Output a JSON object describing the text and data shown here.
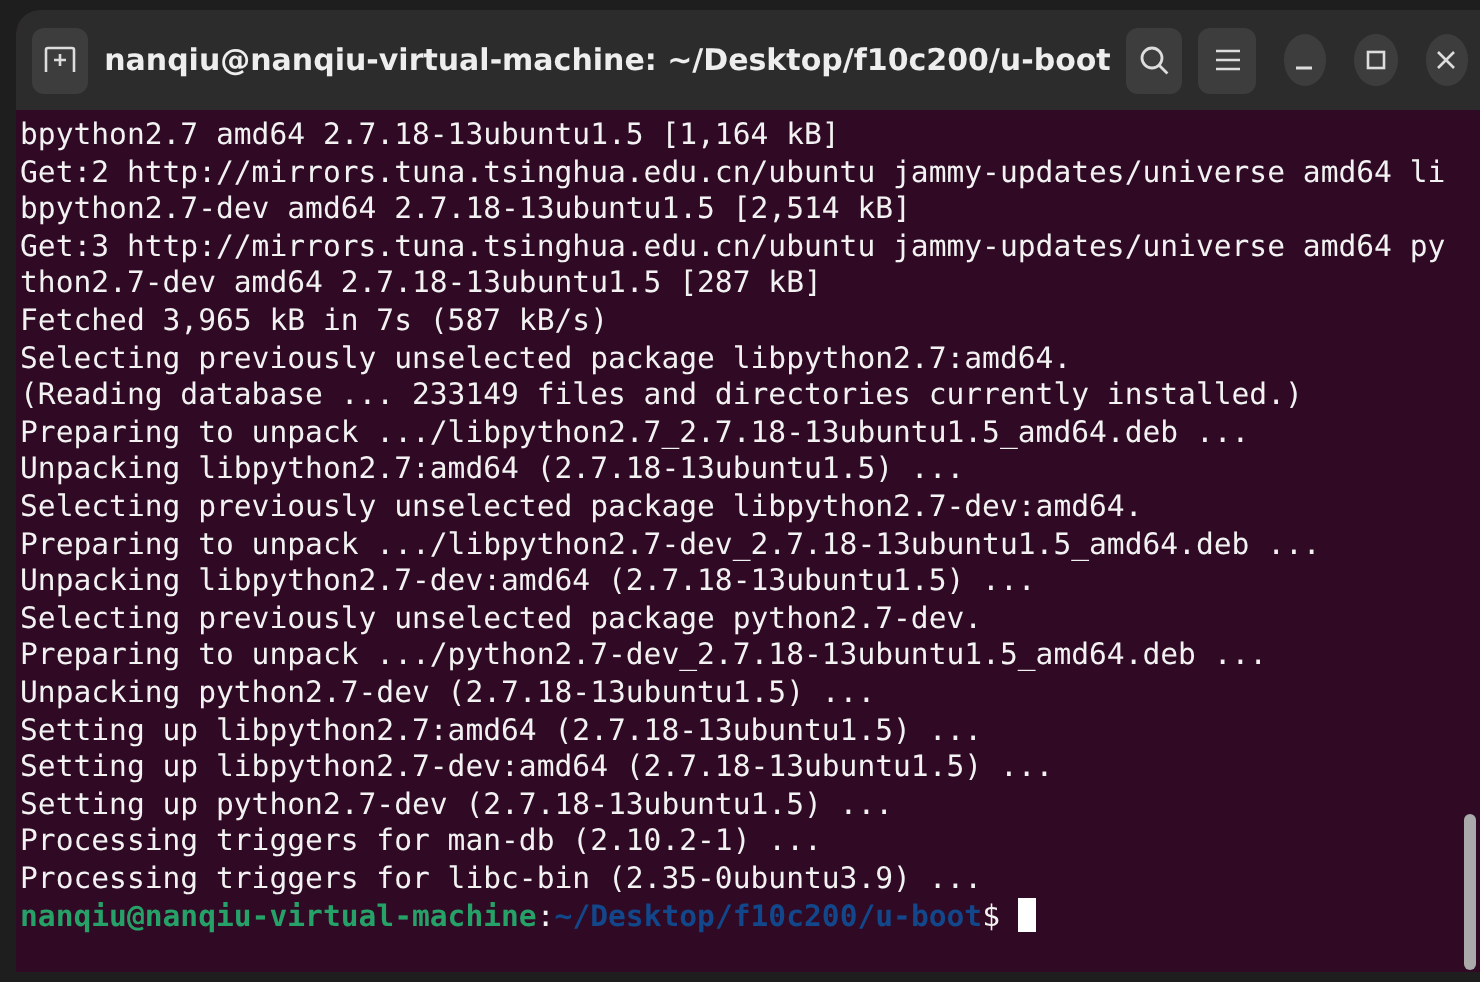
{
  "window": {
    "title": "nanqiu@nanqiu-virtual-machine: ~/Desktop/f10c200/u-boot"
  },
  "terminal": {
    "lines": [
      "bpython2.7 amd64 2.7.18-13ubuntu1.5 [1,164 kB]",
      "Get:2 http://mirrors.tuna.tsinghua.edu.cn/ubuntu jammy-updates/universe amd64 li",
      "bpython2.7-dev amd64 2.7.18-13ubuntu1.5 [2,514 kB]",
      "Get:3 http://mirrors.tuna.tsinghua.edu.cn/ubuntu jammy-updates/universe amd64 py",
      "thon2.7-dev amd64 2.7.18-13ubuntu1.5 [287 kB]",
      "Fetched 3,965 kB in 7s (587 kB/s)",
      "Selecting previously unselected package libpython2.7:amd64.",
      "(Reading database ... 233149 files and directories currently installed.)",
      "Preparing to unpack .../libpython2.7_2.7.18-13ubuntu1.5_amd64.deb ...",
      "Unpacking libpython2.7:amd64 (2.7.18-13ubuntu1.5) ...",
      "Selecting previously unselected package libpython2.7-dev:amd64.",
      "Preparing to unpack .../libpython2.7-dev_2.7.18-13ubuntu1.5_amd64.deb ...",
      "Unpacking libpython2.7-dev:amd64 (2.7.18-13ubuntu1.5) ...",
      "Selecting previously unselected package python2.7-dev.",
      "Preparing to unpack .../python2.7-dev_2.7.18-13ubuntu1.5_amd64.deb ...",
      "Unpacking python2.7-dev (2.7.18-13ubuntu1.5) ...",
      "Setting up libpython2.7:amd64 (2.7.18-13ubuntu1.5) ...",
      "Setting up libpython2.7-dev:amd64 (2.7.18-13ubuntu1.5) ...",
      "Setting up python2.7-dev (2.7.18-13ubuntu1.5) ...",
      "Processing triggers for man-db (2.10.2-1) ...",
      "Processing triggers for libc-bin (2.35-0ubuntu3.9) ..."
    ],
    "prompt": {
      "user_host": "nanqiu@nanqiu-virtual-machine",
      "separator": ":",
      "path": "~/Desktop/f10c200/u-boot",
      "symbol": "$"
    }
  }
}
